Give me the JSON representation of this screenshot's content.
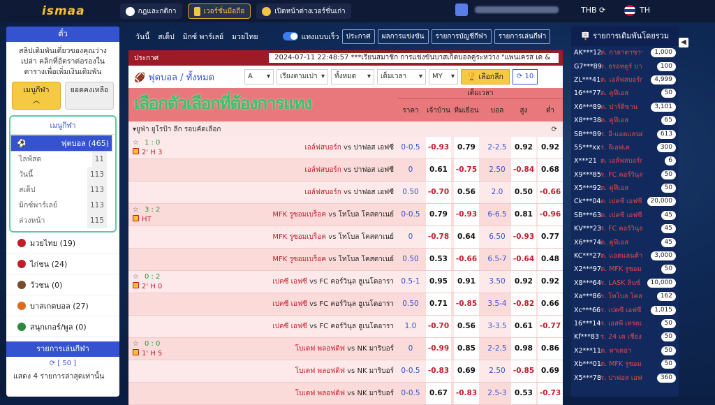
{
  "header": {
    "logo": "ismaa",
    "rules": "กฎและกติกา",
    "mobile": "เวอร์ชั่นมือถือ",
    "old": "เปิดหน้าต่างเวอร์ชั่นเก่า",
    "currency": "THB",
    "lang": "TH"
  },
  "left": {
    "title": "ตั๋ว",
    "notice": "สลิปเดิมพันเดี่ยวของคุณว่างเปล่า คลิกที่อัตราต่อรองในตารางเพื่อเพิ่มเงินเดิมพัน",
    "tab_menu": "เมนูกีฬา",
    "tab_balance": "ยอดคงเหลือ",
    "menu_head": "เมนูกีฬา",
    "football": "ฟุตบอล (465)",
    "subs": [
      {
        "label": "ไลฟ์สด",
        "count": "11"
      },
      {
        "label": "วันนี้",
        "count": "113"
      },
      {
        "label": "สเต็ป",
        "count": "113"
      },
      {
        "label": "มิกซ์พาร์เลย์",
        "count": "113"
      },
      {
        "label": "ล่วงหน้า",
        "count": "115"
      }
    ],
    "sports": [
      {
        "label": "มวยไทย (19)",
        "color": "#c21d2b"
      },
      {
        "label": "ไก่ชน (24)",
        "color": "#c21d2b"
      },
      {
        "label": "วัวชน (0)",
        "color": "#7a4b2a"
      },
      {
        "label": "บาสเกตบอล (27)",
        "color": "#e06a1c"
      },
      {
        "label": "สนุกเกอร์/พูล (0)",
        "color": "#2b8a3e"
      }
    ],
    "recent_title": "รายการเล่นกีฬา",
    "recent_count": "[ 50 ]",
    "recent_text": "แสดง 4 รายการล่าสุดเท่านั้น"
  },
  "center": {
    "subnav": [
      "วันนี้",
      "สเต็ป",
      "มิกซ์ พาร์เลย์",
      "มวยไทย"
    ],
    "fast": "แทงแบบเร็ว",
    "btns": [
      "ประกาศ",
      "ผลการแข่งขัน",
      "รายการบัญชีกีฬา",
      "รายการเล่นกีฬา"
    ],
    "ticker_label": "ประกาศ",
    "ticker": "2024-07-11 22:48:57 ***เรียนสมาชิก การแข่งขันบาสเก็ตบอลคู่ระหว่าง \"แพนเครส เด &",
    "breadcrumb": "ฟุตบอล / ทั้งหมด",
    "f1": "A",
    "f2": "เรียงตามเปา",
    "f3": "ทั้งหมด",
    "f4": "เต็มเวลา",
    "f5": "MY",
    "choose": "เลือกลีก",
    "ten": "10",
    "banner": "เลือกตัวเลือกที่ต้องการแทง",
    "fulltime": "เต็มเวลา",
    "cols": [
      "ราคา",
      "เจ้าบ้าน",
      "ทีมเยือน",
      "บอล",
      "สูง",
      "ต่ำ"
    ],
    "league": "ยูฟ่า ยูโรป้า ลีก รอบคัดเลือก",
    "rows": [
      {
        "score": "1 : 0",
        "time": "2' H 3",
        "home": "เอล์ฟสบอร์ก",
        "vs": "vs",
        "away": "ปาฟอส เอฟซี",
        "hdp": "0-0.5",
        "h": "-0.93",
        "a": "0.79",
        "ou": "2-2.5",
        "o": "0.92",
        "u": "0.92",
        "hr": 1,
        "ar": 0,
        "or": 0,
        "ur": 0
      },
      {
        "score": "",
        "time": "",
        "home": "เอล์ฟสบอร์ก",
        "vs": "vs",
        "away": "ปาฟอส เอฟซี",
        "hdp": "0",
        "h": "0.61",
        "a": "-0.75",
        "ou": "2.50",
        "o": "-0.84",
        "u": "0.68",
        "hr": 0,
        "ar": 1,
        "or": 1,
        "ur": 0
      },
      {
        "score": "",
        "time": "",
        "home": "เอล์ฟสบอร์ก",
        "vs": "vs",
        "away": "ปาฟอส เอฟซี",
        "hdp": "0.50",
        "h": "-0.70",
        "a": "0.56",
        "ou": "2.0",
        "o": "0.50",
        "u": "-0.66",
        "hr": 1,
        "ar": 0,
        "or": 0,
        "ur": 1
      },
      {
        "score": "3 : 2",
        "time": "HT",
        "home": "MFK รูซอมเบร็อค",
        "vs": "vs",
        "away": "โทโบล โคสตาเนย์",
        "hdp": "0-0.5",
        "h": "0.79",
        "a": "-0.93",
        "ou": "6-6.5",
        "o": "0.81",
        "u": "-0.96",
        "hr": 0,
        "ar": 1,
        "or": 0,
        "ur": 1
      },
      {
        "score": "",
        "time": "",
        "home": "MFK รูซอมเบร็อค",
        "vs": "vs",
        "away": "โทโบล โคสตาเนย์",
        "hdp": "0",
        "h": "-0.78",
        "a": "0.64",
        "ou": "6.50",
        "o": "-0.93",
        "u": "0.77",
        "hr": 1,
        "ar": 0,
        "or": 1,
        "ur": 0
      },
      {
        "score": "",
        "time": "",
        "home": "MFK รูซอมเบร็อค",
        "vs": "vs",
        "away": "โทโบล โคสตาเนย์",
        "hdp": "0.50",
        "h": "0.53",
        "a": "-0.66",
        "ou": "6.5-7",
        "o": "-0.64",
        "u": "0.48",
        "hr": 0,
        "ar": 1,
        "or": 1,
        "ur": 0
      },
      {
        "score": "0 : 2",
        "time": "2' H 0",
        "home": "เปคซี เอฟซี",
        "vs": "vs",
        "away": "FC คอร์วินุล ฮูเนโดอารา",
        "hdp": "0.5-1",
        "h": "0.95",
        "a": "0.91",
        "ou": "3.50",
        "o": "0.92",
        "u": "0.92",
        "hr": 0,
        "ar": 0,
        "or": 0,
        "ur": 0
      },
      {
        "score": "",
        "time": "",
        "home": "เปคซี เอฟซี",
        "vs": "vs",
        "away": "FC คอร์วินุล ฮูเนโดอารา",
        "hdp": "0.50",
        "h": "0.71",
        "a": "-0.85",
        "ou": "3.5-4",
        "o": "-0.82",
        "u": "0.66",
        "hr": 0,
        "ar": 1,
        "or": 1,
        "ur": 0
      },
      {
        "score": "",
        "time": "",
        "home": "เปคซี เอฟซี",
        "vs": "vs",
        "away": "FC คอร์วินุล ฮูเนโดอารา",
        "hdp": "1.0",
        "h": "-0.70",
        "a": "0.56",
        "ou": "3-3.5",
        "o": "0.61",
        "u": "-0.77",
        "hr": 1,
        "ar": 0,
        "or": 0,
        "ur": 1
      },
      {
        "score": "0 : 0",
        "time": "1' H 5",
        "home": "โบเตฟ พลอฟดิฟ",
        "vs": "vs",
        "away": "NK มาริบอร์",
        "hdp": "0",
        "h": "-0.99",
        "a": "0.85",
        "ou": "2-2.5",
        "o": "0.98",
        "u": "0.86",
        "hr": 1,
        "ar": 0,
        "or": 0,
        "ur": 0
      },
      {
        "score": "",
        "time": "",
        "home": "โบเตฟ พลอฟดิฟ",
        "vs": "vs",
        "away": "NK มาริบอร์",
        "hdp": "0-0.5",
        "h": "-0.83",
        "a": "0.69",
        "ou": "2.50",
        "o": "-0.85",
        "u": "0.69",
        "hr": 1,
        "ar": 0,
        "or": 1,
        "ur": 0
      },
      {
        "score": "",
        "time": "",
        "home": "โบเตฟ พลอฟดิฟ",
        "vs": "vs",
        "away": "NK มาริบอร์",
        "hdp": "0-0.5",
        "h": "0.67",
        "a": "-0.83",
        "ou": "2.5-3",
        "o": "0.53",
        "u": "-0.73",
        "hr": 0,
        "ar": 1,
        "or": 0,
        "ur": 1
      }
    ]
  },
  "right": {
    "title": "รายการเดิมพันโดยรวม",
    "items": [
      {
        "u": "AK***12",
        "d": "ต. กาลาตาซาราย",
        "a": "1,000"
      },
      {
        "u": "G7***89",
        "d": "ร. ธรอทตูร์ บาเซล",
        "a": "100"
      },
      {
        "u": "ZL***41",
        "d": "ต. เอล์ฟสบอร์ก",
        "a": "4,999"
      },
      {
        "u": "16***77",
        "d": "ต. คูฟีเอส",
        "a": "50"
      },
      {
        "u": "X6***89",
        "d": "ต. ปาร์ติซาน",
        "a": "3,101"
      },
      {
        "u": "X8***38",
        "d": "ต. คูฟีเอส",
        "a": "65"
      },
      {
        "u": "SB***89",
        "d": "ร. อี-แอตแลนต้า",
        "a": "613"
      },
      {
        "u": "55***xx",
        "d": "ร. จีเอฟเค",
        "a": "300"
      },
      {
        "u": "X***21",
        "d": "ต. เอล์ฟสบอร์ก",
        "a": "6"
      },
      {
        "u": "X9***85",
        "d": "ร. FC คอร์วินุล",
        "a": "50"
      },
      {
        "u": "X5***92",
        "d": "ต. คูฟีเอส",
        "a": "50"
      },
      {
        "u": "Ck***04",
        "d": "ต. เปคซี เอฟซี",
        "a": "20,000"
      },
      {
        "u": "SB***63",
        "d": "ต. เปคซี เอฟซี",
        "a": "45"
      },
      {
        "u": "KV***23",
        "d": "ร. FC คอร์วินุล",
        "a": "45"
      },
      {
        "u": "X6***74",
        "d": "ต. คูฟีเอส",
        "a": "45"
      },
      {
        "u": "KC***27",
        "d": "ต. แอตแลนต้า",
        "a": "3,000"
      },
      {
        "u": "X2***97",
        "d": "ต. MFK รูซอม",
        "a": "50"
      },
      {
        "u": "X8***64",
        "d": "ร. LASK ลินซ์",
        "a": "10,000"
      },
      {
        "u": "Xa***86",
        "d": "ร. โทโบล โคสตา",
        "a": "162"
      },
      {
        "u": "Xc***66",
        "d": "ร. เปคซี เอฟซี",
        "a": "1,015"
      },
      {
        "u": "16***14",
        "d": "ร. เอสพี เทรดเดอร์",
        "a": "50"
      },
      {
        "u": "Kf***83",
        "d": "ร. 24 เค เชียงฮาย",
        "a": "50"
      },
      {
        "u": "X2***11",
        "d": "ต. หาเดอา",
        "a": "50"
      },
      {
        "u": "Xb***01",
        "d": "ต. MFK รูซอม",
        "a": "50"
      },
      {
        "u": "X5***78",
        "d": "ร. ปาฟอส เอฟซี",
        "a": "360"
      }
    ]
  }
}
